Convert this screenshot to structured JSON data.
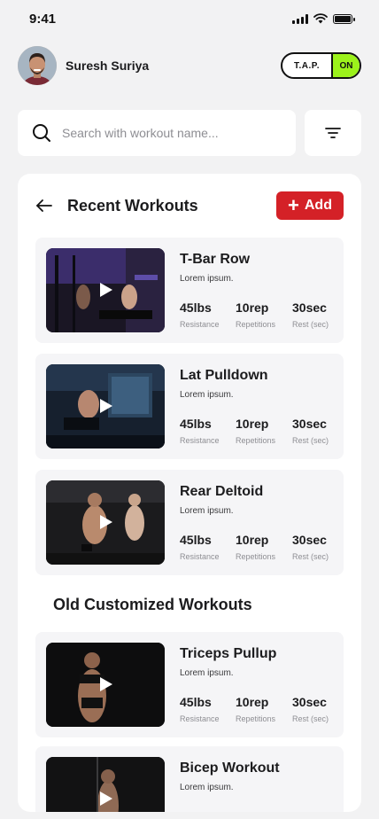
{
  "status": {
    "time": "9:41"
  },
  "user": {
    "name": "Suresh Suriya"
  },
  "tap_toggle": {
    "label": "T.A.P.",
    "state": "ON",
    "accent": "#9cf21b"
  },
  "search": {
    "placeholder": "Search with workout name..."
  },
  "recent": {
    "title": "Recent Workouts",
    "add_label": "Add",
    "workouts": [
      {
        "name": "T-Bar Row",
        "desc": "Lorem ipsum.",
        "resistance": "45lbs",
        "repetitions": "10rep",
        "rest": "30sec",
        "resistance_label": "Resistance",
        "repetitions_label": "Repetitions",
        "rest_label": "Rest (sec)"
      },
      {
        "name": "Lat Pulldown",
        "desc": "Lorem ipsum.",
        "resistance": "45lbs",
        "repetitions": "10rep",
        "rest": "30sec",
        "resistance_label": "Resistance",
        "repetitions_label": "Repetitions",
        "rest_label": "Rest (sec)"
      },
      {
        "name": "Rear Deltoid",
        "desc": "Lorem ipsum.",
        "resistance": "45lbs",
        "repetitions": "10rep",
        "rest": "30sec",
        "resistance_label": "Resistance",
        "repetitions_label": "Repetitions",
        "rest_label": "Rest (sec)"
      }
    ]
  },
  "old": {
    "title": "Old Customized Workouts",
    "workouts": [
      {
        "name": "Triceps Pullup",
        "desc": "Lorem ipsum.",
        "resistance": "45lbs",
        "repetitions": "10rep",
        "rest": "30sec",
        "resistance_label": "Resistance",
        "repetitions_label": "Repetitions",
        "rest_label": "Rest (sec)"
      },
      {
        "name": "Bicep Workout",
        "desc": "Lorem ipsum."
      }
    ]
  },
  "colors": {
    "primary_red": "#d42127",
    "background": "#f2f2f3",
    "card": "#f5f5f7"
  }
}
